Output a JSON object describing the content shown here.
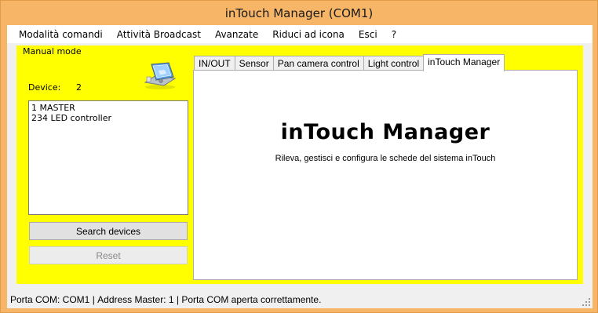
{
  "window": {
    "title": "inTouch Manager (COM1)"
  },
  "menu": [
    "Modalità comandi",
    "Attività Broadcast",
    "Avanzate",
    "Riduci ad icona",
    "Esci",
    "?"
  ],
  "left_panel": {
    "group_label": "Manual mode",
    "device_label": "Device:",
    "device_count": "2",
    "devices": [
      "1 MASTER",
      "234 LED controller"
    ],
    "search_button": "Search devices",
    "reset_button": "Reset"
  },
  "tabs": [
    {
      "label": "IN/OUT",
      "active": false
    },
    {
      "label": "Sensor",
      "active": false
    },
    {
      "label": "Pan camera control",
      "active": false
    },
    {
      "label": "Light control",
      "active": false
    },
    {
      "label": "inTouch Manager",
      "active": true
    }
  ],
  "panel": {
    "title": "inTouch Manager",
    "subtitle": "Rileva, gestisci e configura le schede del sistema  inTouch"
  },
  "status": {
    "port": "Porta COM: COM1",
    "address": "Address Master: 1",
    "message": "Porta COM aperta correttamente."
  },
  "colors": {
    "frame": "#f7b567",
    "panel_background": "#ffff00"
  },
  "icons": {
    "device_icon": "pda-device-icon",
    "resize_grip": "resize-grip-icon"
  }
}
